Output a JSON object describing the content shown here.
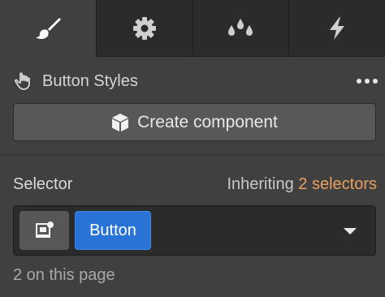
{
  "tabs": [
    {
      "icon": "paintbrush-icon",
      "active": true
    },
    {
      "icon": "gear-icon",
      "active": false
    },
    {
      "icon": "droplets-icon",
      "active": false
    },
    {
      "icon": "lightning-icon",
      "active": false
    }
  ],
  "header": {
    "title": "Button Styles",
    "left_icon": "hand-pointer-icon",
    "right_icon": "more-dots-icon"
  },
  "create_component": {
    "label": "Create component",
    "icon": "cube-icon"
  },
  "selector": {
    "label": "Selector",
    "inheriting_prefix": "Inheriting",
    "inheriting_link": "2 selectors",
    "chip_label": "Button",
    "icon": "element-style-icon",
    "dropdown_icon": "chevron-down-icon",
    "count_text": "2 on this page"
  },
  "colors": {
    "accent_link": "#e8a05c",
    "chip": "#2a73d6",
    "panel_bg": "#404040"
  }
}
